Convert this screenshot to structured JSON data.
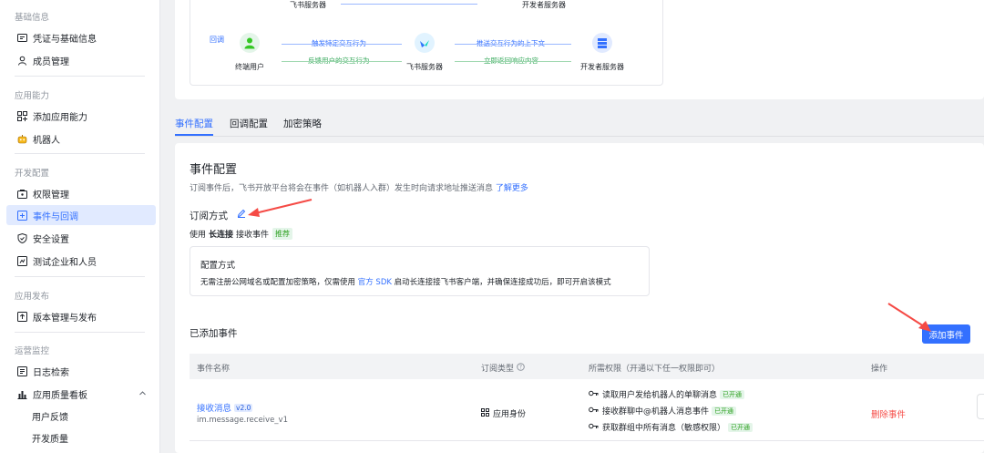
{
  "sidebar": {
    "sections": [
      {
        "title": "基础信息",
        "items": [
          {
            "label": "凭证与基础信息",
            "icon": "credential-icon"
          },
          {
            "label": "成员管理",
            "icon": "member-icon"
          }
        ]
      },
      {
        "title": "应用能力",
        "items": [
          {
            "label": "添加应用能力",
            "icon": "add-capability-icon"
          },
          {
            "label": "机器人",
            "icon": "robot-icon"
          }
        ]
      },
      {
        "title": "开发配置",
        "items": [
          {
            "label": "权限管理",
            "icon": "permission-icon"
          },
          {
            "label": "事件与回调",
            "icon": "event-icon",
            "active": true
          },
          {
            "label": "安全设置",
            "icon": "shield-icon"
          },
          {
            "label": "测试企业和人员",
            "icon": "test-icon"
          }
        ]
      },
      {
        "title": "应用发布",
        "items": [
          {
            "label": "版本管理与发布",
            "icon": "version-icon"
          }
        ]
      },
      {
        "title": "运营监控",
        "items": [
          {
            "label": "日志检索",
            "icon": "log-icon"
          },
          {
            "label": "应用质量看板",
            "icon": "chart-icon"
          },
          {
            "label": "用户反馈"
          },
          {
            "label": "开发质量"
          }
        ]
      }
    ]
  },
  "diagram": {
    "top_server": "飞书服务器",
    "top_dev": "开发者服务器",
    "callback_tag": "回调",
    "end_user": "终端用户",
    "feishu_server": "飞书服务器",
    "dev_server": "开发者服务器",
    "flow_trigger": "触发特定交互行为",
    "flow_feedback": "反馈用户的交互行为",
    "flow_push": "推送交互行为的上下文",
    "flow_return": "立即返回响应内容",
    "colors": {
      "blue": "#3370ff",
      "green": "#34a85a"
    }
  },
  "tabs": [
    {
      "label": "事件配置",
      "active": true
    },
    {
      "label": "回调配置"
    },
    {
      "label": "加密策略"
    }
  ],
  "event_config": {
    "title": "事件配置",
    "desc": "订阅事件后，飞书开放平台将会在事件（如机器人入群）发生时向请求地址推送消息",
    "learn_more": "了解更多",
    "sub_method_label": "订阅方式",
    "use_prefix": "使用",
    "use_mode": "长连接",
    "use_suffix": "接收事件",
    "recommended": "推荐",
    "cfg_title": "配置方式",
    "cfg_desc_a": "无需注册公网域名或配置加密策略，仅需使用",
    "cfg_desc_link": "官方 SDK",
    "cfg_desc_b": "启动长连接接飞书客户端，并确保连接成功后，即可开启该模式"
  },
  "added_events": {
    "title": "已添加事件",
    "add_button": "添加事件",
    "columns": [
      "事件名称",
      "订阅类型",
      "所需权限（开通以下任一权限即可）",
      "操作"
    ],
    "rows": [
      {
        "name": "接收消息",
        "version": "v2.0",
        "key": "im.message.receive_v1",
        "type": "应用身份",
        "permissions": [
          {
            "label": "读取用户发给机器人的单聊消息",
            "status": "已开通"
          },
          {
            "label": "接收群聊中@机器人消息事件",
            "status": "已开通"
          },
          {
            "label": "获取群组中所有消息（敏感权限）",
            "status": "已开通"
          }
        ],
        "action": "删除事件"
      }
    ]
  }
}
